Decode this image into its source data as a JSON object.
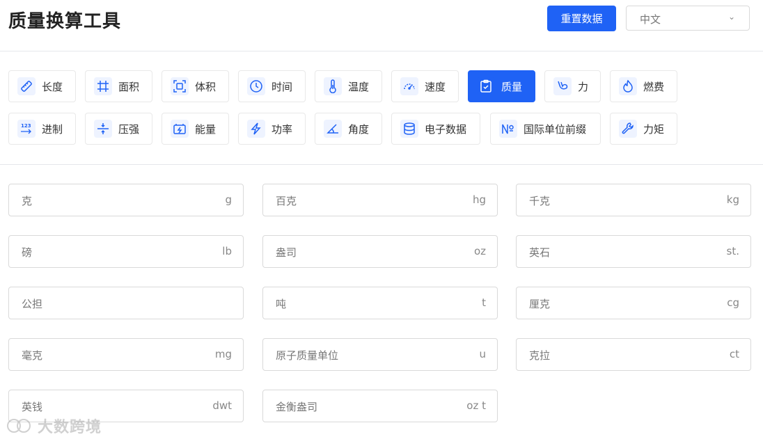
{
  "header": {
    "title": "质量换算工具",
    "reset_label": "重置数据",
    "language_value": "中文"
  },
  "categories": [
    {
      "label": "长度",
      "icon": "ruler-icon"
    },
    {
      "label": "面积",
      "icon": "hash-icon"
    },
    {
      "label": "体积",
      "icon": "scan-frame-icon"
    },
    {
      "label": "时间",
      "icon": "clock-icon"
    },
    {
      "label": "温度",
      "icon": "thermometer-icon"
    },
    {
      "label": "速度",
      "icon": "speedometer-icon"
    },
    {
      "label": "质量",
      "icon": "clipboard-check-icon",
      "active": true
    },
    {
      "label": "力",
      "icon": "bicep-icon"
    },
    {
      "label": "燃费",
      "icon": "flame-icon"
    },
    {
      "label": "进制",
      "icon": "numbers-123-icon"
    },
    {
      "label": "压强",
      "icon": "compress-icon"
    },
    {
      "label": "能量",
      "icon": "battery-charge-icon"
    },
    {
      "label": "功率",
      "icon": "lightning-icon"
    },
    {
      "label": "角度",
      "icon": "angle-icon"
    },
    {
      "label": "电子数据",
      "icon": "database-icon"
    },
    {
      "label": "国际单位前缀",
      "icon": "numero-icon"
    },
    {
      "label": "力矩",
      "icon": "wrench-icon"
    }
  ],
  "units": [
    {
      "name": "克",
      "unit": "g"
    },
    {
      "name": "百克",
      "unit": "hg"
    },
    {
      "name": "千克",
      "unit": "kg"
    },
    {
      "name": "磅",
      "unit": "lb"
    },
    {
      "name": "盎司",
      "unit": "oz"
    },
    {
      "name": "英石",
      "unit": "st."
    },
    {
      "name": "公担",
      "unit": ""
    },
    {
      "name": "吨",
      "unit": "t"
    },
    {
      "name": "厘克",
      "unit": "cg"
    },
    {
      "name": "毫克",
      "unit": "mg"
    },
    {
      "name": "原子质量单位",
      "unit": "u"
    },
    {
      "name": "克拉",
      "unit": "ct"
    },
    {
      "name": "英钱",
      "unit": "dwt"
    },
    {
      "name": "金衡盎司",
      "unit": "oz t"
    }
  ],
  "watermark": {
    "text": "大数跨境"
  },
  "colors": {
    "accent": "#1f62f5",
    "icon_bg": "#eef3ff"
  }
}
